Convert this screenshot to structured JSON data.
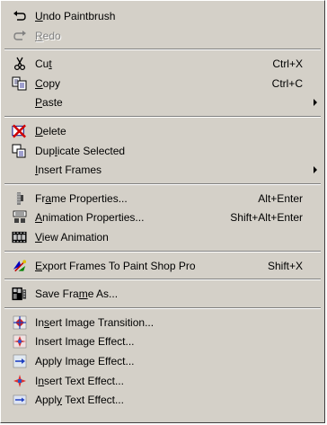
{
  "menu": {
    "groups": [
      [
        {
          "name": "undo-paintbrush",
          "label_pre": "",
          "label_key": "U",
          "label_post": "ndo Paintbrush",
          "icon": "undo-icon",
          "enabled": true,
          "shortcut": "",
          "submenu": false
        },
        {
          "name": "redo",
          "label_pre": "",
          "label_key": "R",
          "label_post": "edo",
          "icon": "redo-icon",
          "enabled": false,
          "shortcut": "",
          "submenu": false
        }
      ],
      [
        {
          "name": "cut",
          "label_pre": "Cu",
          "label_key": "t",
          "label_post": "",
          "icon": "scissors-icon",
          "enabled": true,
          "shortcut": "Ctrl+X",
          "submenu": false
        },
        {
          "name": "copy",
          "label_pre": "",
          "label_key": "C",
          "label_post": "opy",
          "icon": "copy-icon",
          "enabled": true,
          "shortcut": "Ctrl+C",
          "submenu": false
        },
        {
          "name": "paste",
          "label_pre": "",
          "label_key": "P",
          "label_post": "aste",
          "icon": "",
          "enabled": true,
          "shortcut": "",
          "submenu": true
        }
      ],
      [
        {
          "name": "delete",
          "label_pre": "",
          "label_key": "D",
          "label_post": "elete",
          "icon": "delete-icon",
          "enabled": true,
          "shortcut": "",
          "submenu": false
        },
        {
          "name": "duplicate-selected",
          "label_pre": "Dup",
          "label_key": "l",
          "label_post": "icate Selected",
          "icon": "duplicate-icon",
          "enabled": true,
          "shortcut": "",
          "submenu": false
        },
        {
          "name": "insert-frames",
          "label_pre": "",
          "label_key": "I",
          "label_post": "nsert Frames",
          "icon": "",
          "enabled": true,
          "shortcut": "",
          "submenu": true
        }
      ],
      [
        {
          "name": "frame-properties",
          "label_pre": "Fr",
          "label_key": "a",
          "label_post": "me Properties...",
          "icon": "frame-properties-icon",
          "enabled": true,
          "shortcut": "Alt+Enter",
          "submenu": false
        },
        {
          "name": "animation-properties",
          "label_pre": "",
          "label_key": "A",
          "label_post": "nimation Properties...",
          "icon": "animation-properties-icon",
          "enabled": true,
          "shortcut": "Shift+Alt+Enter",
          "submenu": false
        },
        {
          "name": "view-animation",
          "label_pre": "",
          "label_key": "V",
          "label_post": "iew Animation",
          "icon": "film-icon",
          "enabled": true,
          "shortcut": "",
          "submenu": false
        }
      ],
      [
        {
          "name": "export-frames",
          "label_pre": "",
          "label_key": "E",
          "label_post": "xport Frames To Paint Shop Pro",
          "icon": "export-icon",
          "enabled": true,
          "shortcut": "Shift+X",
          "submenu": false
        }
      ],
      [
        {
          "name": "save-frame-as",
          "label_pre": "Save Fra",
          "label_key": "m",
          "label_post": "e As...",
          "icon": "save-frame-icon",
          "enabled": true,
          "shortcut": "",
          "submenu": false
        }
      ],
      [
        {
          "name": "insert-image-transition",
          "label_pre": "In",
          "label_key": "s",
          "label_post": "ert Image Transition...",
          "icon": "image-transition-icon",
          "enabled": true,
          "shortcut": "",
          "submenu": false
        },
        {
          "name": "insert-image-effect",
          "label_pre": "Insert Image Effect...",
          "label_key": "",
          "label_post": "",
          "icon": "image-effect-icon",
          "enabled": true,
          "shortcut": "",
          "submenu": false
        },
        {
          "name": "apply-image-effect",
          "label_pre": "Apply Image Effect...",
          "label_key": "",
          "label_post": "",
          "icon": "apply-image-effect-icon",
          "enabled": true,
          "shortcut": "",
          "submenu": false
        },
        {
          "name": "insert-text-effect",
          "label_pre": "I",
          "label_key": "n",
          "label_post": "sert Text Effect...",
          "icon": "text-effect-icon",
          "enabled": true,
          "shortcut": "",
          "submenu": false
        },
        {
          "name": "apply-text-effect",
          "label_pre": "Appl",
          "label_key": "y",
          "label_post": " Text Effect...",
          "icon": "apply-text-effect-icon",
          "enabled": true,
          "shortcut": "",
          "submenu": false
        }
      ]
    ]
  }
}
